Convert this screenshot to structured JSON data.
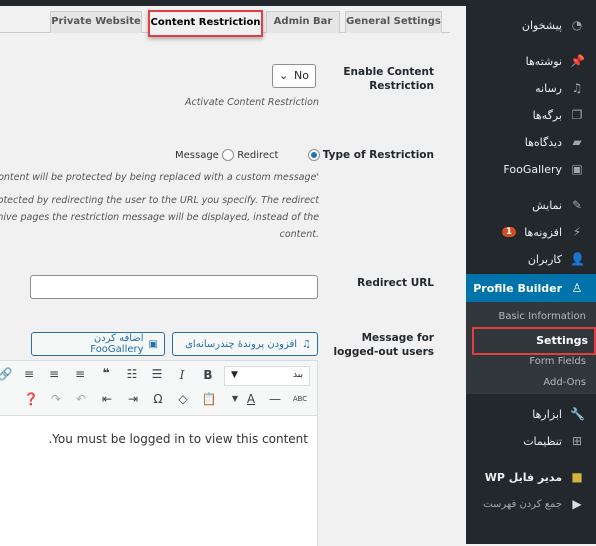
{
  "tabs": [
    {
      "label": "Private Website"
    },
    {
      "label": "Content Restriction"
    },
    {
      "label": "Admin Bar"
    },
    {
      "label": "General Settings"
    }
  ],
  "enable": {
    "label": "Enable Content Restriction",
    "value": "No",
    "desc": "Activate Content Restriction"
  },
  "type": {
    "label": "Type of Restriction",
    "options": [
      "Message",
      "Redirect"
    ],
    "selected": "Message",
    "desc1": "'s content will be protected by being replaced with a custom message",
    "desc2": "protected by redirecting the user to the URL you specify. The redirect",
    "desc3": "archive pages the restriction message will be displayed, instead of the",
    "desc4": ".content"
  },
  "redirect": {
    "label": "Redirect URL",
    "value": ""
  },
  "message": {
    "label": "Message for logged-out users",
    "add_media": "افزودن پروندهٔ چندرسانه‌ای",
    "add_foogallery": "اضافه کردن FooGallery",
    "format": "بند",
    "content": ".You must be logged in to view this content"
  },
  "sidebar": {
    "items": [
      {
        "label": "پیشخوان",
        "icon": "dashboard-icon"
      },
      {
        "label": "نوشته‌ها",
        "icon": "pin-icon"
      },
      {
        "label": "رسانه",
        "icon": "media-icon"
      },
      {
        "label": "برگه‌ها",
        "icon": "pages-icon"
      },
      {
        "label": "دیدگاه‌ها",
        "icon": "comments-icon"
      },
      {
        "label": "FooGallery",
        "icon": "gallery-icon"
      },
      {
        "label": "نمایش",
        "icon": "appearance-icon"
      },
      {
        "label": "افزونه‌ها",
        "icon": "plugins-icon",
        "badge": "1"
      },
      {
        "label": "کاربران",
        "icon": "users-icon"
      },
      {
        "label": "Profile Builder",
        "icon": "user-icon"
      },
      {
        "label": "ابزارها",
        "icon": "tools-icon"
      },
      {
        "label": "تنظیمات",
        "icon": "settings-icon"
      },
      {
        "label": "WP مدیر فایل",
        "icon": "folder-icon"
      },
      {
        "label": "جمع کردن فهرست",
        "icon": "collapse-icon"
      }
    ],
    "submenu": [
      "Basic Information",
      "Settings",
      "Form Fields",
      "Add-Ons"
    ]
  },
  "colors": {
    "accent": "#0073aa",
    "highlight": "#e0403f",
    "sidebar": "#23282d"
  }
}
